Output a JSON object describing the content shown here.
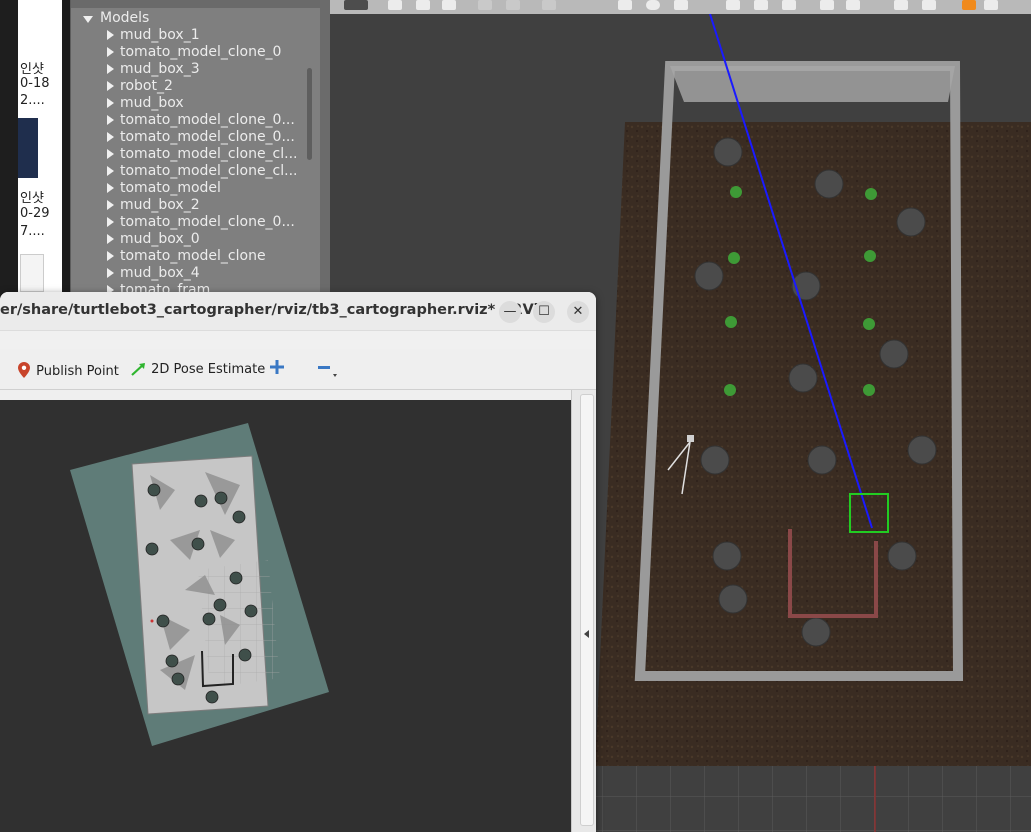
{
  "file_manager": {
    "lines": [
      "인샷",
      "0-18",
      "2....",
      "인샷",
      "0-29",
      "7...."
    ]
  },
  "model_tree": {
    "header": "Models",
    "items": [
      "mud_box_1",
      "tomato_model_clone_0",
      "mud_box_3",
      "robot_2",
      "mud_box",
      "tomato_model_clone_0...",
      "tomato_model_clone_0...",
      "tomato_model_clone_cl...",
      "tomato_model_clone_cl...",
      "tomato_model",
      "mud_box_2",
      "tomato_model_clone_0...",
      "mud_box_0",
      "tomato_model_clone",
      "mud_box_4",
      "tomato_fram"
    ]
  },
  "rviz": {
    "title": "er/share/turtlebot3_cartographer/rviz/tb3_cartographer.rviz* - RViz",
    "toolbar": {
      "publish_point": "Publish Point",
      "pose_estimate": "2D Pose Estimate"
    },
    "window_controls": {
      "minimize": "—",
      "maximize": "☐",
      "close": "✕"
    }
  },
  "colors": {
    "soil": "#3a2c22",
    "wall": "#9a9a9a",
    "laser": "#1a1aff",
    "goal_box": "#22cc22",
    "map_bg": "#5f7c78",
    "map_free": "#c8c8c8"
  },
  "icons": {
    "publish_point": "map-pin-icon",
    "pose_estimate": "green-arrow-icon",
    "add": "plus-icon",
    "remove": "minus-icon"
  }
}
